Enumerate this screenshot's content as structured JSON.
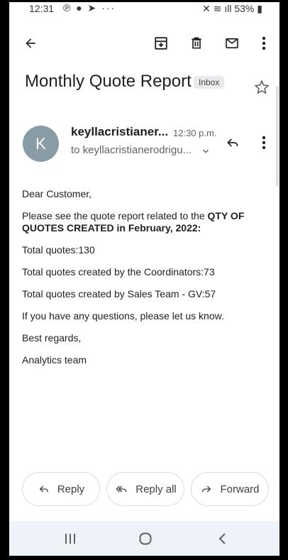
{
  "status_bar": {
    "time": "12:31",
    "icons_left": "℗ ● ➤ ···",
    "battery": "53%"
  },
  "toolbar": {
    "back_icon": "arrow-left-icon",
    "archive_icon": "archive-icon",
    "delete_icon": "trash-icon",
    "mark_unread_icon": "mail-icon",
    "more_icon": "more-vert-icon"
  },
  "email": {
    "subject": "Monthly Quote Report",
    "label": "Inbox",
    "sender_initial": "K",
    "sender": "keyllacristianer...",
    "time": "12:30 p.m.",
    "recipient": "to keyllacristianerodrigu...",
    "body": {
      "greeting": "Dear Customer,",
      "intro": "Please see the quote report related to the ",
      "intro_bold": "QTY OF QUOTES CREATED in February, 2022:",
      "total": "Total quotes:130",
      "coordinators": "Total quotes created by the Coordinators:73",
      "sales": "Total quotes created by Sales Team - GV:57",
      "questions": "If you have any questions, please let us know.",
      "closing": "Best regards,",
      "signature": "Analytics team"
    }
  },
  "actions": {
    "reply": "Reply",
    "reply_all": "Reply all",
    "forward": "Forward"
  }
}
